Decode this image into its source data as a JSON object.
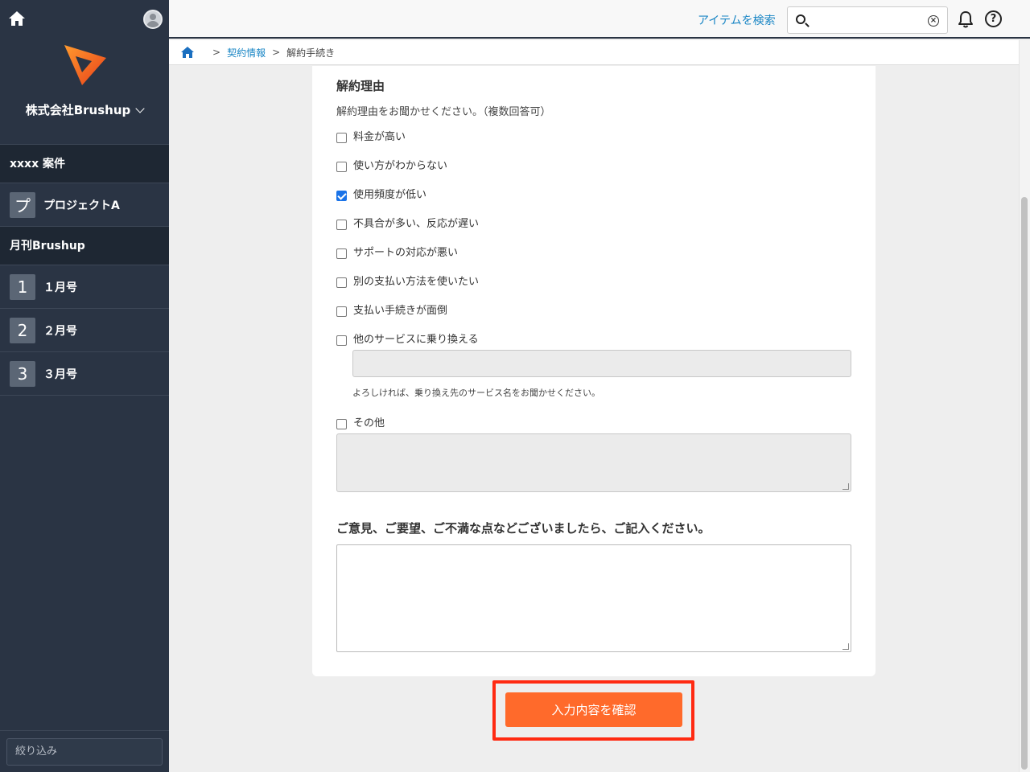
{
  "sidebar": {
    "company": "株式会社Brushup",
    "groups": [
      {
        "label": "xxxx 案件",
        "items": [
          {
            "badge": "プ",
            "label": "プロジェクトA"
          }
        ]
      },
      {
        "label": "月刊Brushup",
        "items": [
          {
            "badge": "1",
            "label": "１月号"
          },
          {
            "badge": "2",
            "label": "２月号"
          },
          {
            "badge": "3",
            "label": "３月号"
          }
        ]
      }
    ],
    "filter_placeholder": "絞り込み"
  },
  "header": {
    "search_link": "アイテムを検索",
    "search_value": "",
    "help_glyph": "?"
  },
  "breadcrumb": {
    "sep": ">",
    "link": "契約情報",
    "current": "解約手続き"
  },
  "form": {
    "section_title": "解約理由",
    "section_subtitle": "解約理由をお聞かせください。（複数回答可）",
    "options": [
      {
        "label": "料金が高い",
        "checked": false
      },
      {
        "label": "使い方がわからない",
        "checked": false
      },
      {
        "label": "使用頻度が低い",
        "checked": true
      },
      {
        "label": "不具合が多い、反応が遅い",
        "checked": false
      },
      {
        "label": "サポートの対応が悪い",
        "checked": false
      },
      {
        "label": "別の支払い方法を使いたい",
        "checked": false
      },
      {
        "label": "支払い手続きが面倒",
        "checked": false
      },
      {
        "label": "他のサービスに乗り換える",
        "checked": false
      },
      {
        "label": "その他",
        "checked": false
      }
    ],
    "switch_hint": "よろしければ、乗り換え先のサービス名をお聞かせください。",
    "feedback_title": "ご意見、ご要望、ご不満な点などございましたら、ご記入ください。",
    "feedback_value": "",
    "confirm_label": "入力内容を確認"
  },
  "colors": {
    "sidebar": "#2a3444",
    "accent_link": "#1a86c5",
    "confirm": "#ff6a2b",
    "highlight": "#ff2a12"
  }
}
